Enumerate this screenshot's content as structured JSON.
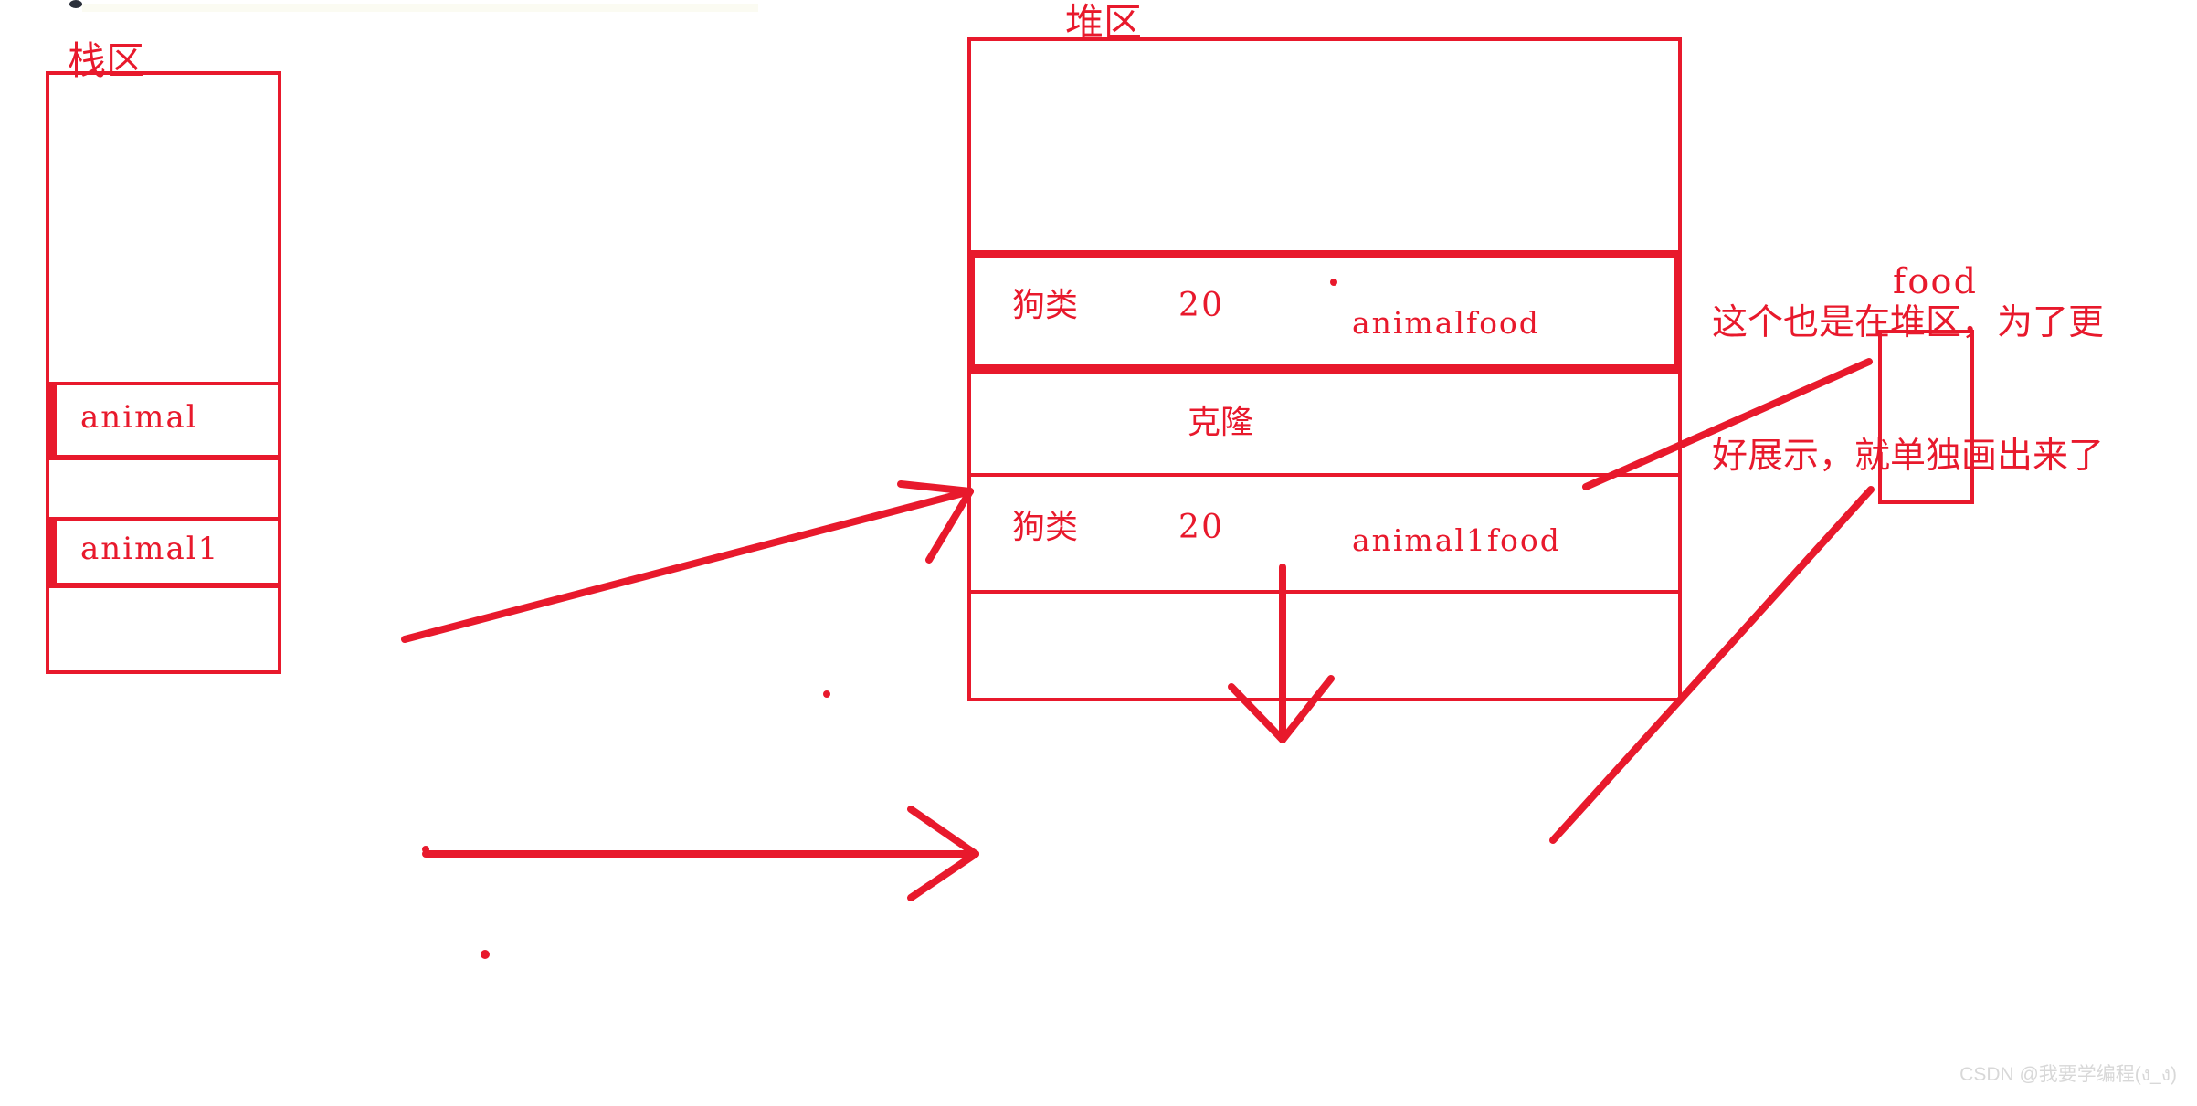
{
  "diagram": {
    "title_stack": "栈区",
    "title_heap": "堆区",
    "annotation": {
      "line1": "这个也是在堆区，为了更",
      "line2": "好展示，就单独画出来了"
    },
    "clone_label": "克隆",
    "accent_color": "#e8192c",
    "background_color": "#ffffff",
    "watermark": "CSDN @我要学编程(ง_ง)"
  },
  "stack": {
    "label": "栈区",
    "cells": [
      {
        "text": ""
      },
      {
        "text": "animal"
      },
      {
        "text": ""
      },
      {
        "text": "animal1"
      },
      {
        "text": ""
      }
    ]
  },
  "heap": {
    "label": "堆区",
    "rows": [
      {
        "type": "",
        "size": "",
        "food": ""
      },
      {
        "type": "狗类",
        "size": "20",
        "food": "animalfood"
      },
      {
        "type": "",
        "size": "",
        "food": ""
      },
      {
        "type": "狗类",
        "size": "20",
        "food": "animal1food"
      },
      {
        "type": "",
        "size": "",
        "food": ""
      }
    ]
  },
  "food_box": {
    "label": "food"
  }
}
